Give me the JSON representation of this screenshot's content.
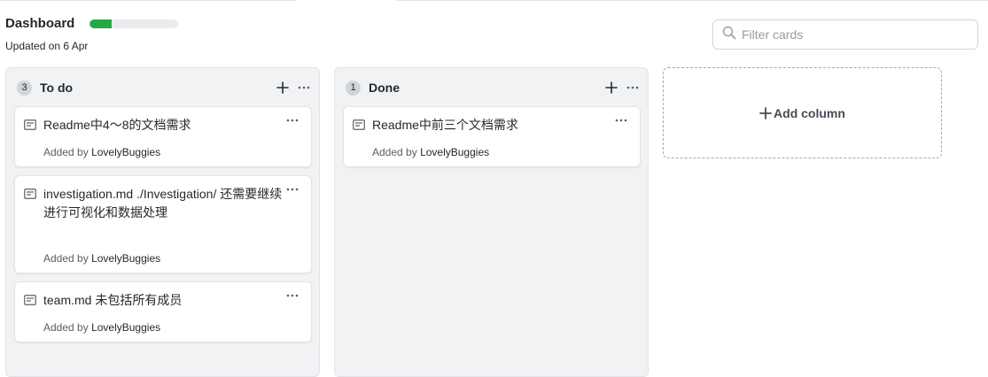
{
  "header": {
    "title": "Dashboard",
    "progress_fraction": 0.25,
    "updated": "Updated on 6 Apr"
  },
  "filter": {
    "placeholder": "Filter cards"
  },
  "columns": [
    {
      "count": "3",
      "title": "To do",
      "cards": [
        {
          "title": "Readme中4～8的文档需求",
          "added_prefix": "Added by",
          "author": "LovelyBuggies"
        },
        {
          "title": "investigation.md ./Investigation/ 还需要继续进行可视化和数据处理",
          "added_prefix": "Added by",
          "author": "LovelyBuggies"
        },
        {
          "title": "team.md 未包括所有成员",
          "added_prefix": "Added by",
          "author": "LovelyBuggies"
        }
      ]
    },
    {
      "count": "1",
      "title": "Done",
      "cards": [
        {
          "title": "Readme中前三个文档需求",
          "added_prefix": "Added by",
          "author": "LovelyBuggies"
        }
      ]
    }
  ],
  "add_column_label": "Add column",
  "colors": {
    "progress": "#28a745",
    "column_bg": "#f1f2f4"
  }
}
